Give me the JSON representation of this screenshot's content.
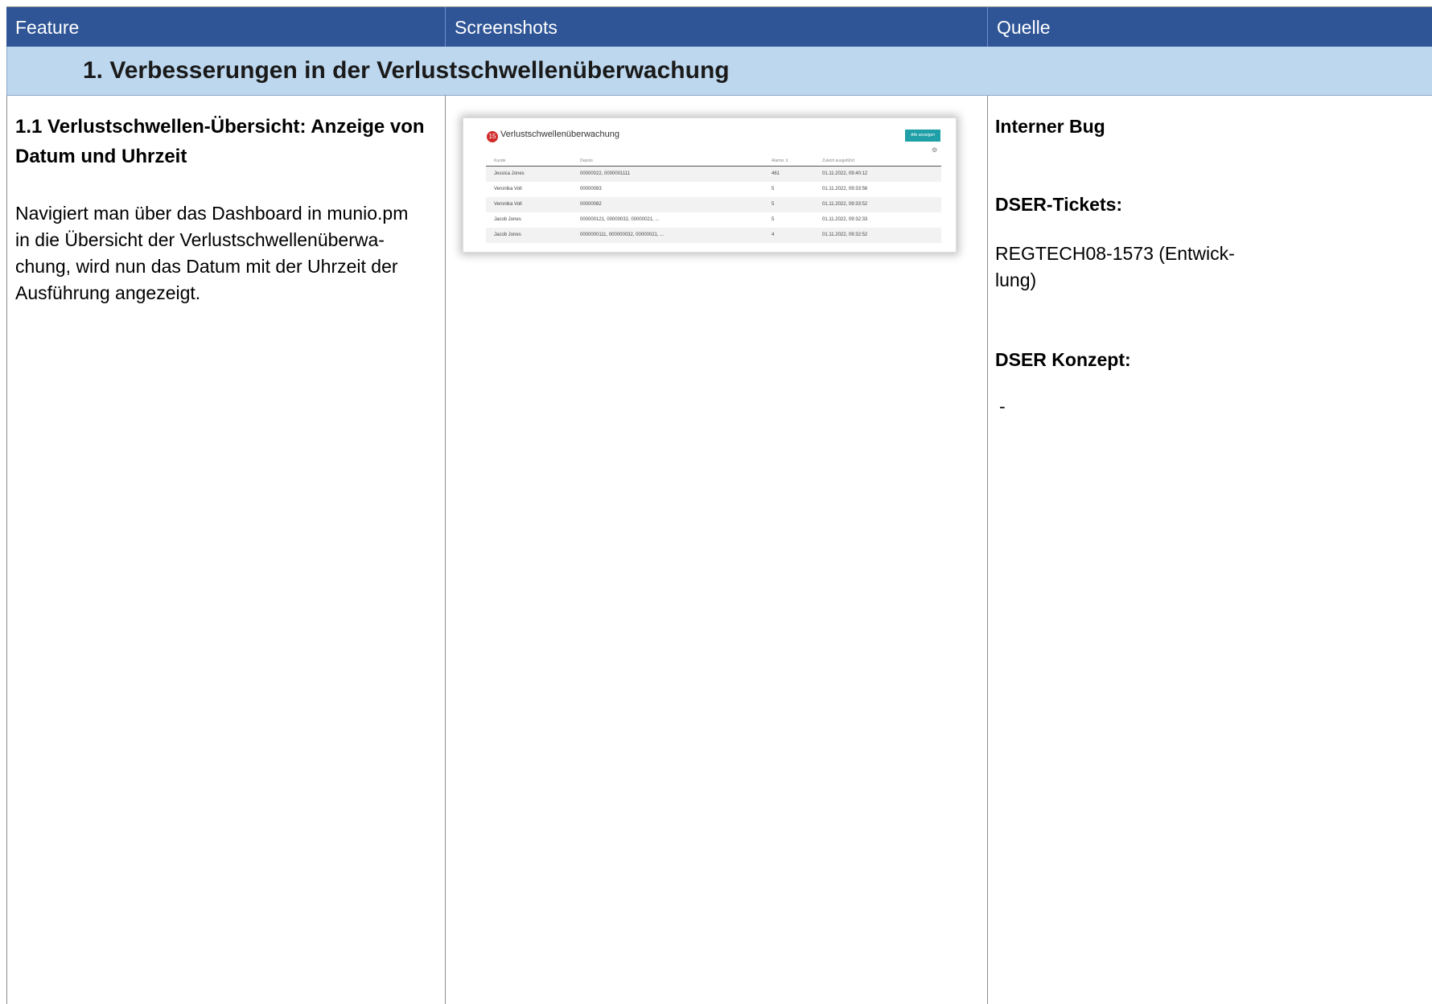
{
  "header": {
    "col_feature": "Feature",
    "col_screenshots": "Screenshots",
    "col_source": "Quelle"
  },
  "section": {
    "title": "1. Verbesserungen in der Verlustschwellenüberwachung"
  },
  "feature": {
    "title": "1.1 Verlustschwellen-Übersicht: Anzeige von Datum und Uhrzeit",
    "lines": [
      "Navigiert man über das Dashboard in munio.pm",
      "in die Übersicht der Verlustschwellenüberwa-",
      "chung, wird nun das Datum mit der Uhrzeit der",
      "Ausführung angezeigt."
    ]
  },
  "source": {
    "internal_bug": "Interner Bug",
    "tickets_label": "DSER-Tickets:",
    "tickets_value_line1": "REGTECH08-1573 (Entwick-",
    "tickets_value_line2": "lung)",
    "concept_label": "DSER Konzept:",
    "concept_value": "-"
  },
  "screenshot": {
    "badge_count": "15",
    "title": "Verlustschwellenüberwachung",
    "button_label": "Alle anzeigen",
    "columns": [
      "Kunde",
      "Depots",
      "Alarms ⇕",
      "Zuletzt ausgeführt"
    ],
    "rows": [
      [
        "Jessica Jones",
        "00000022, 0000001111",
        "461",
        "01.11.2022, 09:40:12"
      ],
      [
        "Veronika Voll",
        "00000083",
        "5",
        "01.11.2022, 09:33:56"
      ],
      [
        "Veronika Voll",
        "00000082",
        "5",
        "01.11.2022, 09:33:52"
      ],
      [
        "Jacob Jones",
        "000000121, 00000032, 00000021, ...",
        "5",
        "01.11.2022, 09:32:33"
      ],
      [
        "Jacob Jones",
        "0000000111, 000000032, 00000021, ...",
        "4",
        "01.11.2022, 09:32:52"
      ]
    ]
  }
}
